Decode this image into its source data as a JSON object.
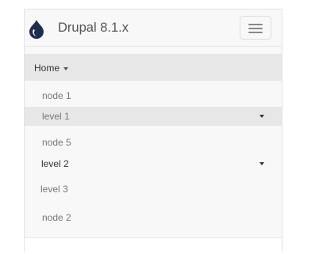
{
  "brand": {
    "name": "Drupal 8.1.x",
    "icon": "drupal-drop-icon"
  },
  "navbar": {
    "toggle_icon": "hamburger-menu-icon"
  },
  "menu": {
    "home": "Home",
    "items": [
      {
        "label": "node 1"
      },
      {
        "label": "level 1"
      },
      {
        "label": "node 5"
      },
      {
        "label": "level 2"
      },
      {
        "label": "level 3"
      },
      {
        "label": "node 2"
      }
    ]
  },
  "colors": {
    "active_bg": "#e7e7e7",
    "navbar_bg": "#f8f8f8",
    "text_muted": "#777777",
    "text_dark": "#333333"
  }
}
